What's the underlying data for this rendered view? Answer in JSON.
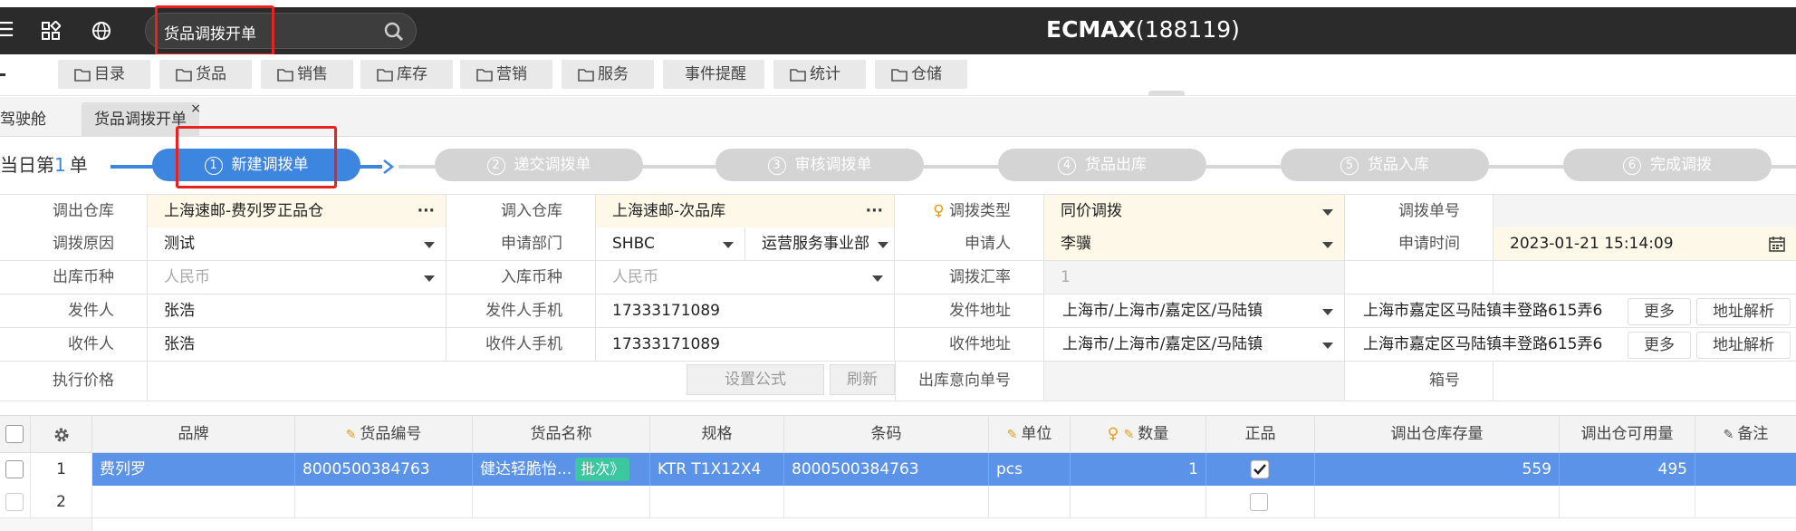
{
  "topbar": {
    "search_value": "货品调拨开单",
    "app_title_brand": "ECMAX",
    "app_title_id": "(188119)"
  },
  "menu": [
    {
      "label": "目录",
      "icon": "folder-icon"
    },
    {
      "label": "货品",
      "icon": "folder-icon"
    },
    {
      "label": "销售",
      "icon": "folder-icon"
    },
    {
      "label": "库存",
      "icon": "folder-icon"
    },
    {
      "label": "营销",
      "icon": "folder-icon"
    },
    {
      "label": "服务",
      "icon": "folder-icon"
    },
    {
      "label": "事件提醒",
      "icon": ""
    },
    {
      "label": "统计",
      "icon": "folder-icon"
    },
    {
      "label": "仓储",
      "icon": "folder-icon"
    }
  ],
  "tabs": [
    {
      "label": "驾驶舱"
    },
    {
      "label": "货品调拨开单",
      "close": "×"
    }
  ],
  "steps": {
    "counter_prefix": "当日第",
    "counter_value": "1",
    "counter_suffix": "单",
    "items": [
      {
        "num": "1",
        "label": "新建调拨单",
        "active": true
      },
      {
        "num": "2",
        "label": "递交调拨单"
      },
      {
        "num": "3",
        "label": "审核调拨单"
      },
      {
        "num": "4",
        "label": "货品出库"
      },
      {
        "num": "5",
        "label": "货品入库"
      },
      {
        "num": "6",
        "label": "完成调拨"
      }
    ]
  },
  "form": {
    "out_warehouse_label": "调出仓库",
    "out_warehouse": "上海速邮-费列罗正品仓",
    "in_warehouse_label": "调入仓库",
    "in_warehouse": "上海速邮-次品库",
    "transfer_type_label": "调拨类型",
    "transfer_type": "同价调拨",
    "transfer_no_label": "调拨单号",
    "transfer_no": "",
    "reason_label": "调拨原因",
    "reason": "测试",
    "dept_label": "申请部门",
    "dept_code": "SHBC",
    "dept_name": "运营服务事业部",
    "applicant_label": "申请人",
    "applicant": "李骥",
    "apply_time_label": "申请时间",
    "apply_time": "2023-01-21 15:14:09",
    "out_currency_label": "出库币种",
    "out_currency": "人民币",
    "in_currency_label": "入库币种",
    "in_currency": "人民币",
    "rate_label": "调拨汇率",
    "rate": "1",
    "sender_label": "发件人",
    "sender": "张浩",
    "sender_phone_label": "发件人手机",
    "sender_phone": "17333171089",
    "sender_addr_label": "发件地址",
    "sender_region": "上海市/上海市/嘉定区/马陆镇",
    "sender_addr": "上海市嘉定区马陆镇丰登路615弄6",
    "receiver_label": "收件人",
    "receiver": "张浩",
    "receiver_phone_label": "收件人手机",
    "receiver_phone": "17333171089",
    "receiver_addr_label": "收件地址",
    "receiver_region": "上海市/上海市/嘉定区/马陆镇",
    "receiver_addr": "上海市嘉定区马陆镇丰登路615弄6",
    "more_label": "更多",
    "parse_label": "地址解析",
    "price_label": "执行价格",
    "price": "",
    "formula_label": "设置公式",
    "refresh_label": "刷新",
    "intent_no_label": "出库意向单号",
    "intent_no": "",
    "box_no_label": "箱号",
    "box_no": ""
  },
  "grid": {
    "headers": {
      "brand": "品牌",
      "code": "货品编号",
      "name": "货品名称",
      "spec": "规格",
      "barcode": "条码",
      "unit": "单位",
      "qty": "数量",
      "genuine": "正品",
      "out_stock": "调出仓库存量",
      "out_avail": "调出仓可用量",
      "remark": "备注"
    },
    "rows": [
      {
        "no": "1",
        "brand": "费列罗",
        "code": "8000500384763",
        "name": "健达轻脆怡...",
        "batch": "批次》",
        "spec": "KTR T1X12X4",
        "barcode": "8000500384763",
        "unit": "pcs",
        "qty": "1",
        "out_stock": "559",
        "out_avail": "495"
      },
      {
        "no": "2"
      }
    ]
  }
}
